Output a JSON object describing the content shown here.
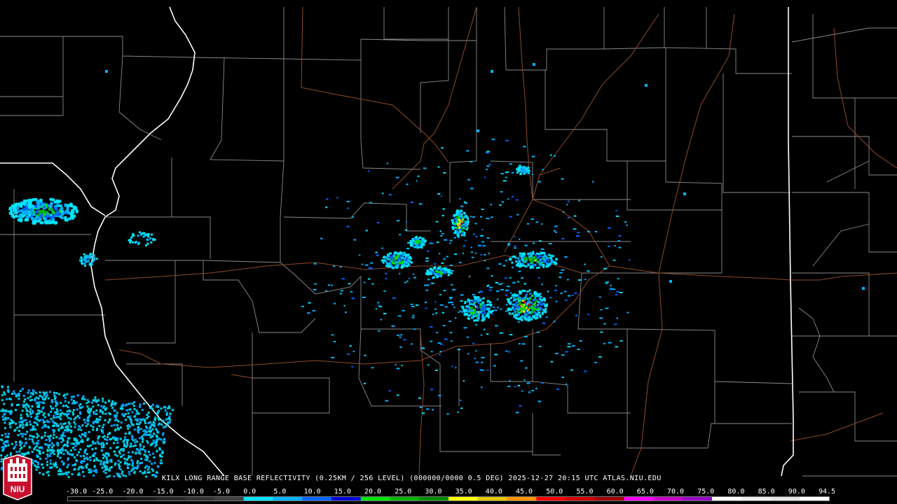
{
  "product": {
    "caption": "KILX LONG RANGE BASE REFLECTIVITY (0.25KM / 256 LEVEL) (000000/0000 0.5 DEG) 2025-12-27 20:15 UTC  ATLAS.NIU.EDU"
  },
  "logo": {
    "text": "NIU"
  },
  "scale": {
    "labels": [
      "-30.0",
      "-25.0",
      "-20.0",
      "-15.0",
      "-10.0",
      "-5.0",
      "0.0",
      "5.0",
      "10.0",
      "15.0",
      "20.0",
      "25.0",
      "30.0",
      "35.0",
      "40.0",
      "45.0",
      "50.0",
      "55.0",
      "60.0",
      "65.0",
      "70.0",
      "75.0",
      "80.0",
      "85.0",
      "90.0",
      "94.5"
    ],
    "colors": [
      "#000000",
      "#0d0d0d",
      "#1a1a1a",
      "#262626",
      "#333333",
      "#404040",
      "#00e5ff",
      "#00b4ff",
      "#0064ff",
      "#0000d8",
      "#00e600",
      "#00b400",
      "#008c00",
      "#ffff00",
      "#e6c800",
      "#ff9600",
      "#ff0000",
      "#d20000",
      "#a00000",
      "#ff00ff",
      "#c800c8",
      "#9600c8",
      "#ffffff",
      "#f0f0f0",
      "#e6e6e6",
      "#ffffff"
    ]
  },
  "colors": {
    "background": "#000000",
    "county_lines": "#8a8a8a",
    "state_lines": "#ffffff",
    "highways": "#8b4a2a"
  }
}
